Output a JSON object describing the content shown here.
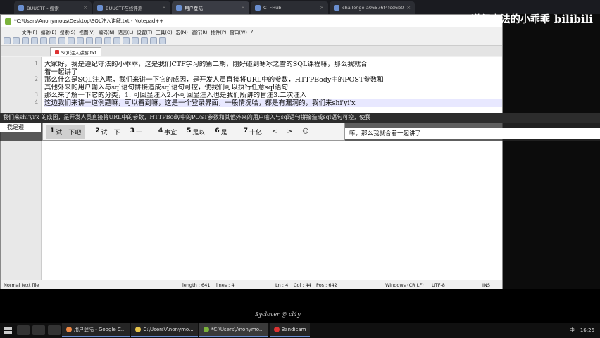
{
  "browser": {
    "tabs": [
      {
        "label": "BUUCTF - 搜索"
      },
      {
        "label": "BUUCTF在线评测"
      },
      {
        "label": "用户登陆"
      },
      {
        "label": "CTFHub"
      },
      {
        "label": "challenge-a06576f4fcd6b0"
      }
    ],
    "brand_text": "遵纪守法的小乖乖",
    "brand_logo": "bilibili"
  },
  "notepad": {
    "title": "*C:\\Users\\Anonymous\\Desktop\\SQL注入讲解.txt - Notepad++",
    "menu": [
      "文件(F)",
      "编辑(E)",
      "搜索(S)",
      "视图(V)",
      "编码(N)",
      "语言(L)",
      "设置(T)",
      "工具(O)",
      "宏(M)",
      "运行(R)",
      "插件(P)",
      "窗口(W)",
      "?"
    ],
    "file_tab": "SQL注入讲解.txt",
    "gutter": [
      "1",
      "",
      "2",
      "",
      "3",
      "4"
    ],
    "lines": [
      "大家好，我是遵纪守法的小乖乖，这是我们CTF学习的第二期，刚好碰到寒冰之雪的SQL课程嘛，那么我就合",
      "着一起讲了",
      "那么什么是SQL注入呢，我们来讲一下它的成因，是开发人员直接将URL中的参数，HTTPBody中的POST参数和",
      "其他外来的用户输入与sql语句拼接造成sql语句可控，使我们可以执行任意sql语句",
      "那么来了解一下它的分类，1. 可回显注入2.不可回显注入也是我们所讲的盲注3.二次注入",
      "这边我们来讲一道例题嘛，可以看到嘛，这是一个登录界面，一般情况哈，都是有漏洞的，我们来shi'yi'x"
    ],
    "status": {
      "type": "Normal text file",
      "length": "length : 641",
      "lines": "lines : 4",
      "ln": "Ln : 4",
      "col": "Col : 44",
      "pos": "Pos : 642",
      "eol": "Windows (CR LF)",
      "encoding": "UTF-8",
      "mode": "INS"
    }
  },
  "ime": {
    "strip": "我们来shi'yi'x  的成因，是开发人员直接将URL中的参数，HTTPBody中的POST参数和其他外来的用户输入与sql语句拼接造成sql语句可控，使我",
    "left": "我是遵",
    "candidates": [
      {
        "num": "1",
        "text": "试一下吧"
      },
      {
        "num": "2",
        "text": "试一下"
      },
      {
        "num": "3",
        "text": "十一"
      },
      {
        "num": "4",
        "text": "事宜"
      },
      {
        "num": "5",
        "text": "是以"
      },
      {
        "num": "6",
        "text": "是一"
      },
      {
        "num": "7",
        "text": "十亿"
      }
    ],
    "prev": "<",
    "next": ">",
    "emoji": "☺",
    "right": "嘛，那么我就合着一起讲了"
  },
  "watermark": "Syclover @ cl4y",
  "taskbar": {
    "apps": [
      {
        "label": "用户登陆 - Google C..."
      },
      {
        "label": "C:\\Users\\Anonymo..."
      },
      {
        "label": "*C:\\Users\\Anonymo..."
      },
      {
        "label": "Bandicam"
      }
    ],
    "ime_indicator": "中",
    "time": "16:26"
  }
}
